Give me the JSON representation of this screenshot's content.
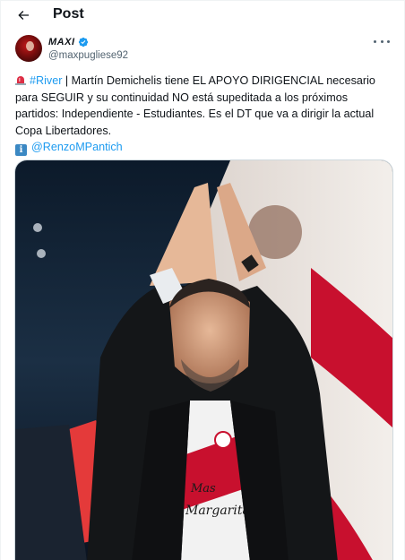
{
  "header": {
    "title": "Post",
    "back_icon": "arrow-left-icon"
  },
  "author": {
    "display_name": "MAXI",
    "handle": "@maxpugliese92",
    "verified": true,
    "verified_color": "#1d9bf0"
  },
  "tweet": {
    "siren_icon": "police-light-icon",
    "hashtag": "#River",
    "text_after_hashtag": " | Martín Demichelis tiene EL APOYO DIRIGENCIAL necesario para SEGUIR y su continuidad NO está supeditada a los próximos partidos: Independiente - Estudiantes. Es el DT que va a dirigir la actual Copa Libertadores.",
    "info_icon": "information-icon",
    "info_icon_glyph": "i",
    "mention": "@RenzoMPantich"
  },
  "media": {
    "shirt_text_line1": "Mas",
    "shirt_text_line2": "Margarita"
  },
  "colors": {
    "link": "#1d9bf0",
    "text": "#0f1419",
    "secondary": "#536471"
  }
}
